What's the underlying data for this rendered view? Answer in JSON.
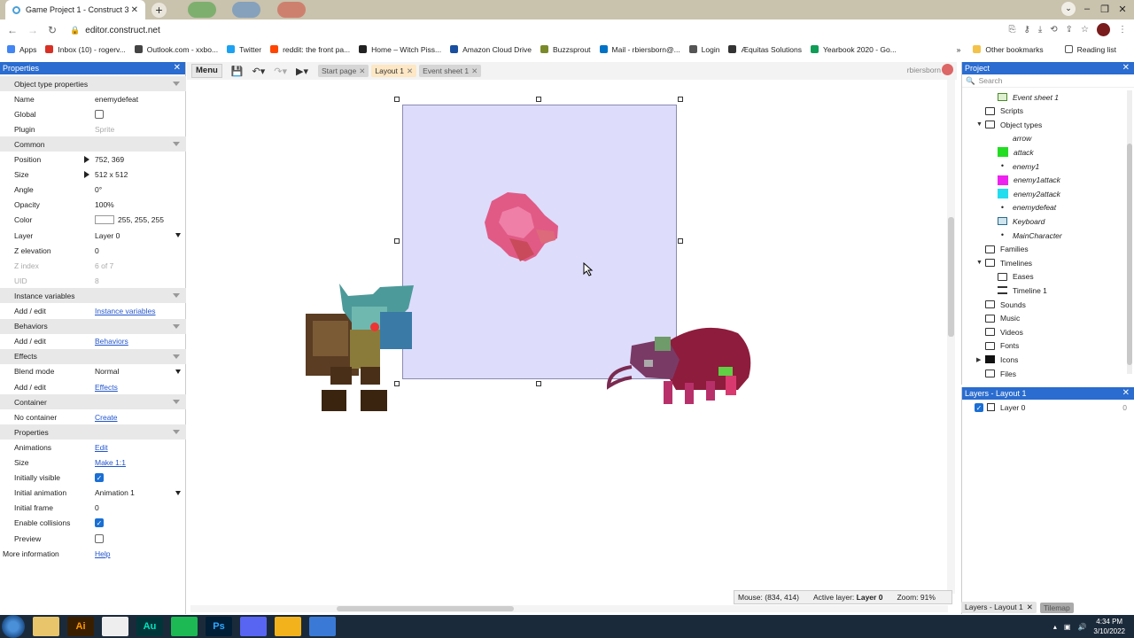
{
  "browser": {
    "tab_title": "Game Project 1 - Construct 3",
    "new_tab_symbol": "+",
    "url": "editor.construct.net",
    "bookmarks": [
      {
        "label": "Apps",
        "color": "#4285f4"
      },
      {
        "label": "Inbox (10) - rogerv...",
        "color": "#d93025"
      },
      {
        "label": "Outlook.com - xxbo...",
        "color": "#444444"
      },
      {
        "label": "Twitter",
        "color": "#1da1f2"
      },
      {
        "label": "reddit: the front pa...",
        "color": "#ff4500"
      },
      {
        "label": "Home – Witch Piss...",
        "color": "#222222"
      },
      {
        "label": "Amazon Cloud Drive",
        "color": "#1a4fa0"
      },
      {
        "label": "Buzzsprout",
        "color": "#7a8a2a"
      },
      {
        "label": "Mail - rbiersborn@...",
        "color": "#0072c6"
      },
      {
        "label": "Login",
        "color": "#555555"
      },
      {
        "label": "Æquitas Solutions",
        "color": "#333333"
      },
      {
        "label": "Yearbook 2020 - Go...",
        "color": "#0f9d58"
      }
    ],
    "other_bookmarks": "Other bookmarks",
    "reading_list": "Reading list"
  },
  "toolbar": {
    "menu_label": "Menu",
    "tabs": [
      {
        "label": "Start page",
        "active": false
      },
      {
        "label": "Layout 1",
        "active": true
      },
      {
        "label": "Event sheet 1",
        "active": false
      }
    ],
    "user": "rbiersborn"
  },
  "properties": {
    "title": "Properties",
    "rows": [
      {
        "type": "section",
        "key": "Object type properties"
      },
      {
        "type": "text",
        "key": "Name",
        "value": "enemydefeat"
      },
      {
        "type": "check",
        "key": "Global",
        "checked": false
      },
      {
        "type": "text",
        "key": "Plugin",
        "value": "Sprite",
        "dim": true,
        "keydim": false
      },
      {
        "type": "section",
        "key": "Common"
      },
      {
        "type": "expand",
        "key": "Position",
        "value": "752, 369"
      },
      {
        "type": "expand",
        "key": "Size",
        "value": "512 x 512"
      },
      {
        "type": "text",
        "key": "Angle",
        "value": "0°"
      },
      {
        "type": "text",
        "key": "Opacity",
        "value": "100%"
      },
      {
        "type": "color",
        "key": "Color",
        "value": "255, 255, 255"
      },
      {
        "type": "select",
        "key": "Layer",
        "value": "Layer 0"
      },
      {
        "type": "text",
        "key": "Z elevation",
        "value": "0"
      },
      {
        "type": "text",
        "key": "Z index",
        "value": "6 of 7",
        "dim": true,
        "keydim": true
      },
      {
        "type": "text",
        "key": "UID",
        "value": "8",
        "dim": true,
        "keydim": true
      },
      {
        "type": "section",
        "key": "Instance variables"
      },
      {
        "type": "link",
        "key": "Add / edit",
        "value": "Instance variables"
      },
      {
        "type": "section",
        "key": "Behaviors"
      },
      {
        "type": "link",
        "key": "Add / edit",
        "value": "Behaviors"
      },
      {
        "type": "section",
        "key": "Effects"
      },
      {
        "type": "select",
        "key": "Blend mode",
        "value": "Normal"
      },
      {
        "type": "link",
        "key": "Add / edit",
        "value": "Effects"
      },
      {
        "type": "section",
        "key": "Container"
      },
      {
        "type": "link",
        "key": "No container",
        "value": "Create"
      },
      {
        "type": "section",
        "key": "Properties"
      },
      {
        "type": "link",
        "key": "Animations",
        "value": "Edit"
      },
      {
        "type": "link",
        "key": "Size",
        "value": "Make 1:1"
      },
      {
        "type": "check",
        "key": "Initially visible",
        "checked": true
      },
      {
        "type": "select",
        "key": "Initial animation",
        "value": "Animation 1"
      },
      {
        "type": "text",
        "key": "Initial frame",
        "value": "0"
      },
      {
        "type": "check",
        "key": "Enable collisions",
        "checked": true
      },
      {
        "type": "check",
        "key": "Preview",
        "checked": false
      },
      {
        "type": "link",
        "key": "More information",
        "value": "Help",
        "flush": true
      }
    ]
  },
  "status": {
    "mouse": "Mouse: (834, 414)",
    "active_layer_label": "Active layer:",
    "active_layer": "Layer 0",
    "zoom": "Zoom: 91%"
  },
  "project": {
    "title": "Project",
    "search_placeholder": "Search",
    "items": [
      {
        "label": "Event sheet 1",
        "icon": "event-sheet",
        "indent": 2,
        "italic": true
      },
      {
        "label": "Scripts",
        "icon": "folder",
        "indent": 1
      },
      {
        "label": "Object types",
        "icon": "folder",
        "indent": 1,
        "expanded": true
      },
      {
        "label": "arrow",
        "icon": "sprite-blank",
        "indent": 2,
        "italic": true
      },
      {
        "label": "attack",
        "icon": "sprite",
        "color": "#22dd22",
        "indent": 2,
        "italic": true
      },
      {
        "label": "enemy1",
        "icon": "sprite-dot",
        "indent": 2,
        "italic": true
      },
      {
        "label": "enemy1attack",
        "icon": "sprite",
        "color": "#ee22ee",
        "indent": 2,
        "italic": true
      },
      {
        "label": "enemy2attack",
        "icon": "sprite",
        "color": "#22ddee",
        "indent": 2,
        "italic": true
      },
      {
        "label": "enemydefeat",
        "icon": "sprite-dot",
        "indent": 2,
        "italic": true
      },
      {
        "label": "Keyboard",
        "icon": "keyboard",
        "indent": 2,
        "italic": true
      },
      {
        "label": "MainCharacter",
        "icon": "sprite-dot",
        "indent": 2,
        "italic": true
      },
      {
        "label": "Families",
        "icon": "folder",
        "indent": 1
      },
      {
        "label": "Timelines",
        "icon": "folder",
        "indent": 1,
        "expanded": true
      },
      {
        "label": "Eases",
        "icon": "folder",
        "indent": 2
      },
      {
        "label": "Timeline 1",
        "icon": "timeline",
        "indent": 2
      },
      {
        "label": "Sounds",
        "icon": "folder",
        "indent": 1
      },
      {
        "label": "Music",
        "icon": "folder",
        "indent": 1
      },
      {
        "label": "Videos",
        "icon": "folder",
        "indent": 1
      },
      {
        "label": "Fonts",
        "icon": "folder",
        "indent": 1
      },
      {
        "label": "Icons",
        "icon": "folder-filled",
        "indent": 1,
        "collapsed": true
      },
      {
        "label": "Files",
        "icon": "folder",
        "indent": 1
      }
    ]
  },
  "layers": {
    "title": "Layers - Layout 1",
    "items": [
      {
        "label": "Layer 0",
        "visible": true,
        "count": "0"
      }
    ],
    "bottom_tabs": [
      "Layers - Layout 1",
      "Tilemap"
    ]
  },
  "taskbar": {
    "apps": [
      {
        "name": "file-explorer-icon",
        "color": "#e8c46a",
        "text": ""
      },
      {
        "name": "illustrator-icon",
        "color": "#3a1e00",
        "text": "Ai",
        "fg": "#ff9a00"
      },
      {
        "name": "chrome-icon",
        "color": "#eeeeee",
        "text": ""
      },
      {
        "name": "audition-icon",
        "color": "#00363a",
        "text": "Au",
        "fg": "#00e4bb"
      },
      {
        "name": "spotify-icon",
        "color": "#1db954",
        "text": ""
      },
      {
        "name": "photoshop-icon",
        "color": "#001e36",
        "text": "Ps",
        "fg": "#31a8ff"
      },
      {
        "name": "discord-icon",
        "color": "#5865f2",
        "text": ""
      },
      {
        "name": "construct-icon",
        "color": "#f2b21b",
        "text": ""
      },
      {
        "name": "grid-app-icon",
        "color": "#3a7ad6",
        "text": ""
      }
    ],
    "time": "4:34 PM",
    "date": "3/10/2022"
  }
}
